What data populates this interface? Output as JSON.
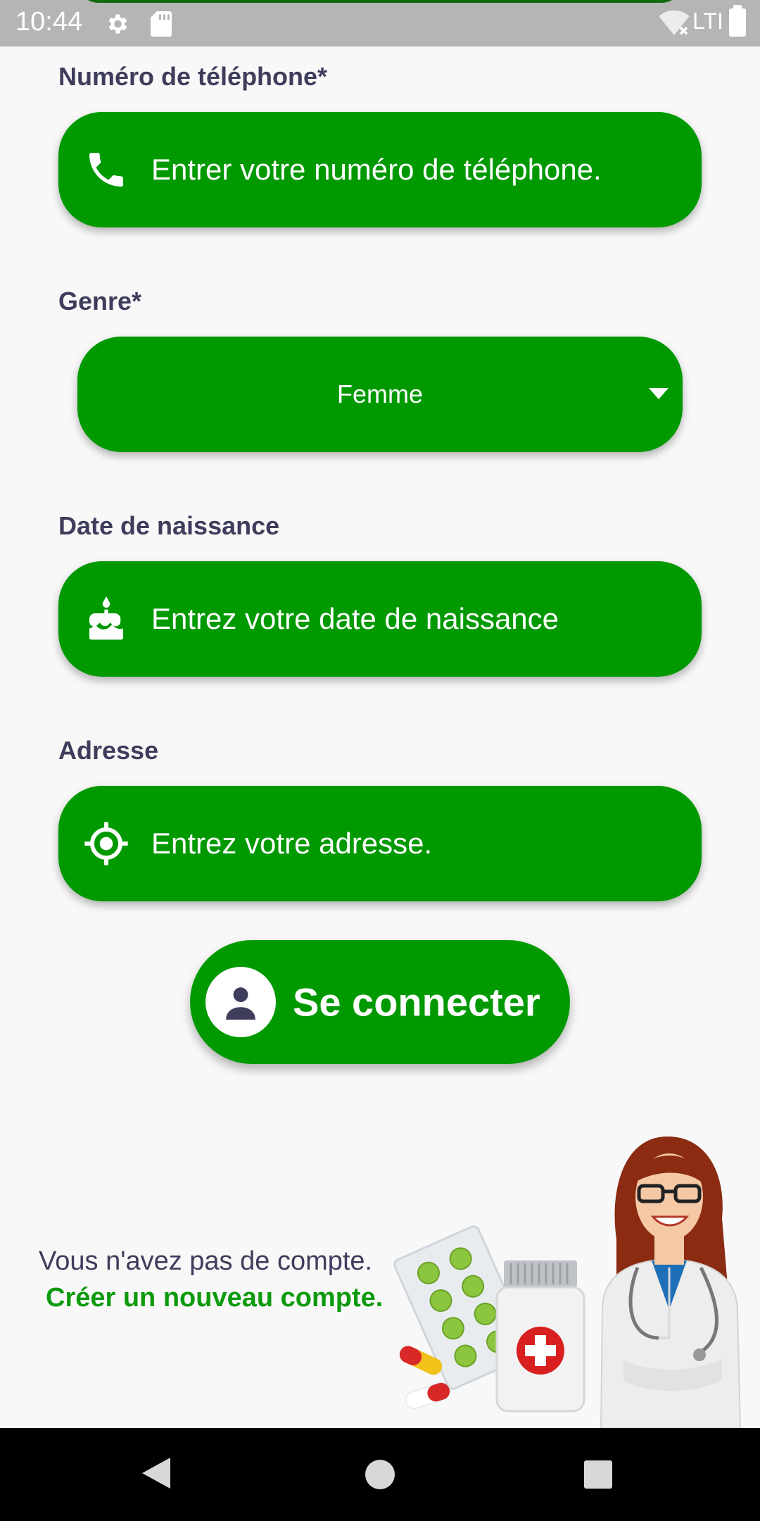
{
  "status_bar": {
    "time": "10:44",
    "network": "LTI",
    "icons": [
      "gear-icon",
      "sd-card-icon",
      "wifi-icon",
      "battery-icon"
    ]
  },
  "form": {
    "phone": {
      "label": "Numéro de téléphone*",
      "placeholder": "Entrer votre numéro de téléphone.",
      "icon": "phone-icon"
    },
    "gender": {
      "label": "Genre*",
      "selected": "Femme",
      "icon": "caret-down-icon"
    },
    "birthdate": {
      "label": "Date de naissance",
      "placeholder": "Entrez votre date de naissance",
      "icon": "cake-icon"
    },
    "address": {
      "label": "Adresse",
      "placeholder": "Entrez votre adresse.",
      "icon": "location-target-icon"
    }
  },
  "login_button": {
    "label": "Se connecter",
    "icon": "person-icon"
  },
  "signup": {
    "prompt": "Vous n'avez pas de compte.",
    "link": "Créer un nouveau compte."
  },
  "colors": {
    "primary": "#009900",
    "label_text": "#3e3d5c",
    "link": "#0d9a0d",
    "background": "#f8f8f8"
  }
}
